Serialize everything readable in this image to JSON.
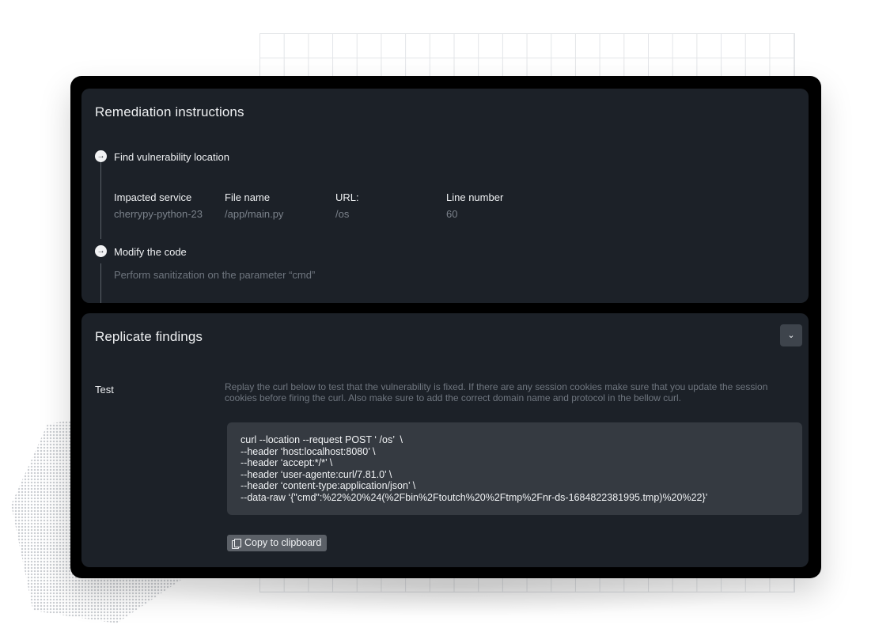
{
  "remediation": {
    "title": "Remediation instructions",
    "steps": [
      {
        "label": "Find vulnerability location",
        "fields": [
          {
            "label": "Impacted service",
            "value": "cherrypy-python-23"
          },
          {
            "label": "File name",
            "value": "/app/main.py"
          },
          {
            "label": "URL:",
            "value": "/os"
          },
          {
            "label": "Line number",
            "value": "60"
          }
        ]
      },
      {
        "label": "Modify the code",
        "description": "Perform sanitization on the parameter “cmd”"
      }
    ]
  },
  "replicate": {
    "title": "Replicate findings",
    "test_label": "Test",
    "test_description": "Replay the curl below to test that the vulnerability is fixed. If there are any session cookies make sure that you update the session cookies before firing the curl. Also make sure to add the correct domain name and protocol in the bellow curl.",
    "code_lines": [
      "curl --location --request POST ‘ /os’  \\",
      "--header ‘host:localhost:8080’ \\",
      "--header ‘accept:*/*’ \\",
      "--header ‘user-agente:curl/7.81.0’ \\",
      "--header ‘content-type:application/json’ \\",
      "--data-raw ‘{\"cmd\":%22%20%24(%2Fbin%2Ftoutch%20%2Ftmp%2Fnr-ds-1684822381995.tmp)%20%22}’"
    ],
    "copy_label": "Copy to clipboard"
  },
  "icons": {
    "step": "arrow-right-circle-icon",
    "collapse": "chevron-down-icon",
    "copy": "copy-icon"
  },
  "colors": {
    "card_bg": "#000000",
    "panel_bg": "#1c2128",
    "code_bg": "#353a41",
    "button_bg": "#5b6067",
    "muted_text": "#6f767f"
  }
}
